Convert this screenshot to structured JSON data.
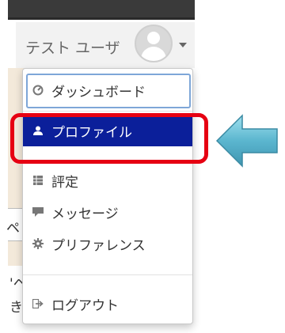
{
  "user": {
    "name": "テスト ユーザ"
  },
  "menu": {
    "items": [
      {
        "label": "ダッシュボード",
        "icon": "dashboard-icon"
      },
      {
        "label": "プロファイル",
        "icon": "user-icon"
      },
      {
        "label": "評定",
        "icon": "table-icon"
      },
      {
        "label": "メッセージ",
        "icon": "comment-icon"
      },
      {
        "label": "プリファレンス",
        "icon": "gear-icon"
      },
      {
        "label": "ログアウト",
        "icon": "sign-out-icon"
      }
    ]
  },
  "background": {
    "fragments": [
      "ペ",
      "'ヘ",
      "き"
    ]
  },
  "colors": {
    "highlight": "#e60012",
    "active_item": "#0b1f9a",
    "arrow": "#5bb6cf"
  }
}
